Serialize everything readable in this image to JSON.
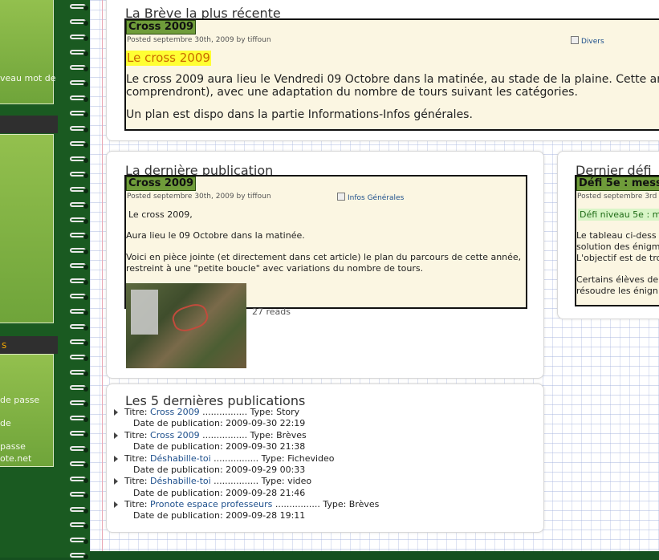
{
  "sidebar": {
    "text1": "veau mot de",
    "heading2": "s",
    "text2a": "de passe",
    "text2b": "de",
    "text2c": "passe",
    "text2d": "ote.net"
  },
  "recent_breve": {
    "section_title": "La Brève la plus récente",
    "post_title": "Cross 2009",
    "meta": "Posted septembre 30th, 2009 by tiffoun",
    "category": "Divers",
    "headline": "Le cross 2009",
    "line1": "Le cross 2009 aura lieu le Vendredi 09 Octobre dans la matinée, au stade de la plaine. Cette ann",
    "line2": "comprendront), avec une adaptation du nombre de tours suivant les catégories.",
    "line3": "Un plan est dispo dans la partie Informations-Infos générales."
  },
  "last_publication": {
    "section_title": "La dernière publication",
    "post_title": "Cross 2009",
    "meta": "Posted septembre 30th, 2009 by tiffoun",
    "category": "Infos Générales",
    "p1": "Le cross 2009,",
    "p2": "Aura lieu le 09 Octobre dans la matinée.",
    "p3a": "Voici en pièce jointe (et directement dans cet article) le plan du parcours de cette année,",
    "p3b": "restreint à une \"petite boucle\" avec variations du nombre de tours.",
    "reads": "27 reads"
  },
  "last_defi": {
    "section_title": "Dernier défi",
    "post_title": "Défi 5e : mess",
    "meta": "Posted septembre 3rd",
    "subtitle": "Défi niveau 5e : me",
    "lines": [
      "Le tableau ci-dess",
      "solution des énigm",
      "L'objectif est de tro",
      "",
      "Certains élèves de",
      "résoudre les énign"
    ]
  },
  "last5": {
    "section_title": "Les 5 dernières publications",
    "items": [
      {
        "prefix": "Titre: ",
        "title": "Cross 2009",
        "dots": " ................ ",
        "type": "Type: Story",
        "date": "Date de publication: 2009-09-30 22:19"
      },
      {
        "prefix": "Titre: ",
        "title": "Cross 2009",
        "dots": " ................ ",
        "type": "Type: Brèves",
        "date": "Date de publication: 2009-09-30 21:38"
      },
      {
        "prefix": "Titre: ",
        "title": "Déshabille-toi",
        "dots": " ................ ",
        "type": "Type: Fichevideo",
        "date": "Date de publication: 2009-09-29 00:33"
      },
      {
        "prefix": "Titre: ",
        "title": "Déshabille-toi",
        "dots": " ................ ",
        "type": "Type: video",
        "date": "Date de publication: 2009-09-28 21:46"
      },
      {
        "prefix": "Titre: ",
        "title": "Pronote espace professeurs",
        "dots": " ................ ",
        "type": "Type: Brèves",
        "date": "Date de publication: 2009-09-28 19:11"
      }
    ]
  },
  "colors": {
    "page_green": "#15501f",
    "post_bg": "#fbf6e2",
    "title_green": "#6f9c3a",
    "highlight": "#ffff33",
    "link": "#1d4f8c"
  }
}
